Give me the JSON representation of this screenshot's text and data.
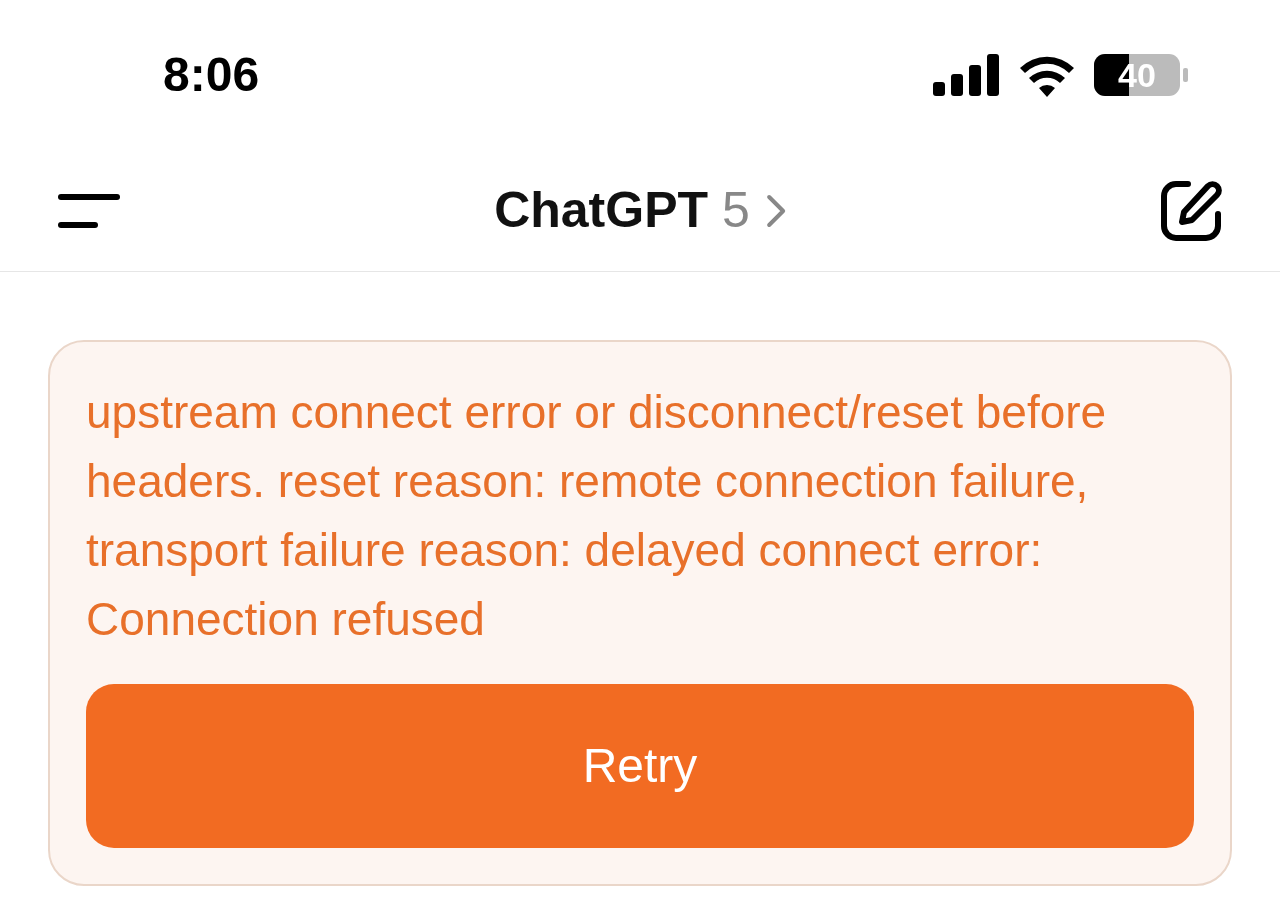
{
  "status_bar": {
    "time": "8:06",
    "battery": "40"
  },
  "header": {
    "title": "ChatGPT",
    "model": "5"
  },
  "error": {
    "message": "upstream connect error or disconnect/reset before headers. reset reason: remote connection failure, transport failure reason: delayed connect error: Connection refused",
    "button": "Retry"
  }
}
